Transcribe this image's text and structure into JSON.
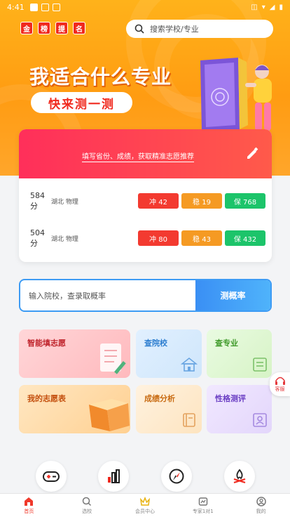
{
  "status_bar": {
    "time": "4:41"
  },
  "header": {
    "logo_chars": [
      "金",
      "榜",
      "提",
      "名"
    ],
    "search_placeholder": "搜索学校/专业"
  },
  "hero": {
    "title": "我适合什么专业",
    "cta": "快来测一测"
  },
  "score_card": {
    "hint": "填写省份、成绩，获取精准志愿推荐",
    "rows": [
      {
        "score": "584分",
        "info": "湖北 物理",
        "chong": "冲 42",
        "wen": "稳 19",
        "bao": "保 768"
      },
      {
        "score": "504分",
        "info": "湖北 物理",
        "chong": "冲 80",
        "wen": "稳 43",
        "bao": "保 432"
      }
    ]
  },
  "query": {
    "placeholder": "输入院校，查录取概率",
    "button": "测概率"
  },
  "tiles": {
    "t1": "智能填志愿",
    "t2": "查院校",
    "t3": "查专业",
    "t4": "我的志愿表",
    "t5": "成绩分析",
    "t6": "性格测评"
  },
  "service": {
    "label": "客服"
  },
  "quick_icons": [
    "gamepad-icon",
    "bar-chart-icon",
    "compass-icon",
    "campfire-icon"
  ],
  "tabbar": {
    "items": [
      {
        "label": "首页",
        "icon": "home-icon",
        "active": true
      },
      {
        "label": "选校",
        "icon": "search-icon",
        "active": false
      },
      {
        "label": "会员中心",
        "icon": "crown-icon",
        "active": false
      },
      {
        "label": "专家1对1",
        "icon": "expert-icon",
        "active": false
      },
      {
        "label": "我的",
        "icon": "user-icon",
        "active": false
      }
    ]
  },
  "colors": {
    "brand_orange": "#ffa61a",
    "accent_red": "#f0291e",
    "chong_red": "#f33a30",
    "wen_orange": "#f59a23",
    "bao_green": "#1cc46a",
    "query_blue": "#3d9bf4"
  }
}
